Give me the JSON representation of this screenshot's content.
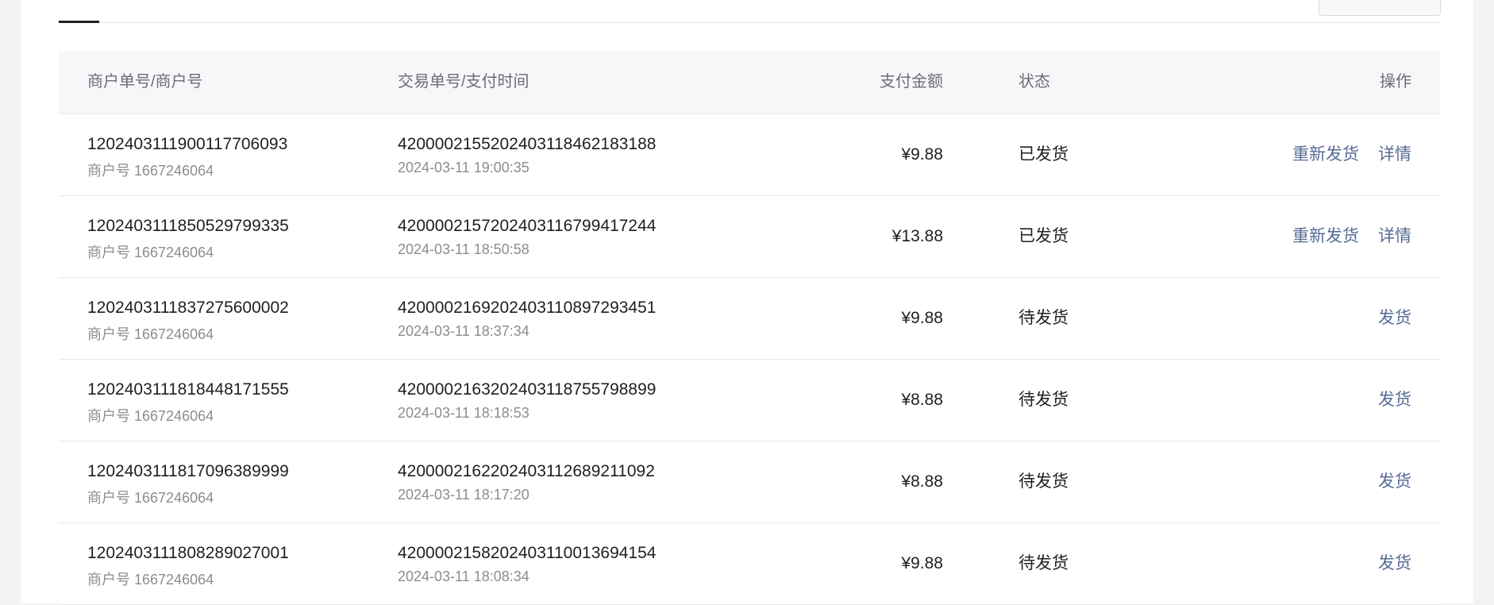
{
  "table": {
    "headers": {
      "merchant_order": "商户单号/商户号",
      "trade_order": "交易单号/支付时间",
      "amount": "支付金额",
      "status": "状态",
      "actions": "操作"
    },
    "rows": [
      {
        "merchant_order_no": "1202403111900117706093",
        "merchant_id": "商户号 1667246064",
        "trade_no": "4200002155202403118462183188",
        "pay_time": "2024-03-11 19:00:35",
        "amount": "¥9.88",
        "status": "已发货",
        "actions": [
          "重新发货",
          "详情"
        ]
      },
      {
        "merchant_order_no": "1202403111850529799335",
        "merchant_id": "商户号 1667246064",
        "trade_no": "4200002157202403116799417244",
        "pay_time": "2024-03-11 18:50:58",
        "amount": "¥13.88",
        "status": "已发货",
        "actions": [
          "重新发货",
          "详情"
        ]
      },
      {
        "merchant_order_no": "1202403111837275600002",
        "merchant_id": "商户号 1667246064",
        "trade_no": "4200002169202403110897293451",
        "pay_time": "2024-03-11 18:37:34",
        "amount": "¥9.88",
        "status": "待发货",
        "actions": [
          "发货"
        ]
      },
      {
        "merchant_order_no": "1202403111818448171555",
        "merchant_id": "商户号 1667246064",
        "trade_no": "4200002163202403118755798899",
        "pay_time": "2024-03-11 18:18:53",
        "amount": "¥8.88",
        "status": "待发货",
        "actions": [
          "发货"
        ]
      },
      {
        "merchant_order_no": "1202403111817096389999",
        "merchant_id": "商户号 1667246064",
        "trade_no": "4200002162202403112689211092",
        "pay_time": "2024-03-11 18:17:20",
        "amount": "¥8.88",
        "status": "待发货",
        "actions": [
          "发货"
        ]
      },
      {
        "merchant_order_no": "1202403111808289027001",
        "merchant_id": "商户号 1667246064",
        "trade_no": "4200002158202403110013694154",
        "pay_time": "2024-03-11 18:08:34",
        "amount": "¥9.88",
        "status": "待发货",
        "actions": [
          "发货"
        ]
      }
    ]
  },
  "colors": {
    "link": "#576b95",
    "header_bg": "#f6f7f9",
    "border": "#e7e8eb"
  }
}
